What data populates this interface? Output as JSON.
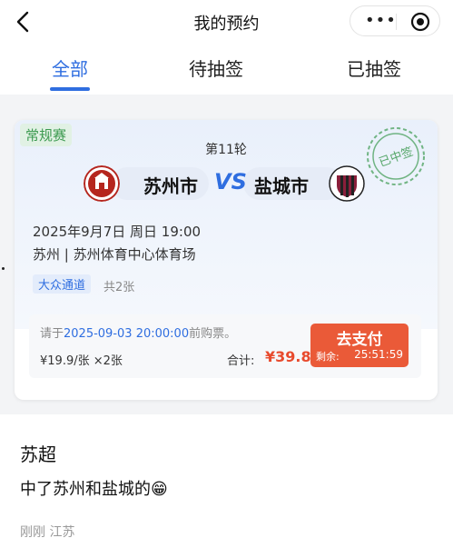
{
  "header": {
    "title": "我的预约",
    "more_icon": "more-dots-icon",
    "target_icon": "record-target-icon"
  },
  "tabs": [
    {
      "label": "全部"
    },
    {
      "label": "待抽签"
    },
    {
      "label": "已抽签"
    }
  ],
  "card": {
    "type_badge": "常规赛",
    "round": "第11轮",
    "stamp": "已中签",
    "home_team": "苏州市",
    "vs": "VS",
    "away_team": "盐城市",
    "datetime": "2025年9月7日 周日 19:00",
    "venue": "苏州 | 苏州体育中心体育场",
    "channel": "大众通道",
    "count": "共2张",
    "deadline_prefix": "请于",
    "deadline": "2025-09-03 20:00:00",
    "deadline_suffix": "前购票。",
    "price": "¥19.9/张 ×2张",
    "total_label": "合计:",
    "total": "¥39.8",
    "pay_label": "去支付",
    "remaining_label": "剩余:",
    "remaining": "25:51:59"
  },
  "post": {
    "title": "苏超",
    "body": "中了苏州和盐城的😁",
    "meta": "刚刚 江苏"
  },
  "colors": {
    "accent": "#2f6ee0",
    "pay": "#ea5a38",
    "stamp": "#3c9a50"
  }
}
